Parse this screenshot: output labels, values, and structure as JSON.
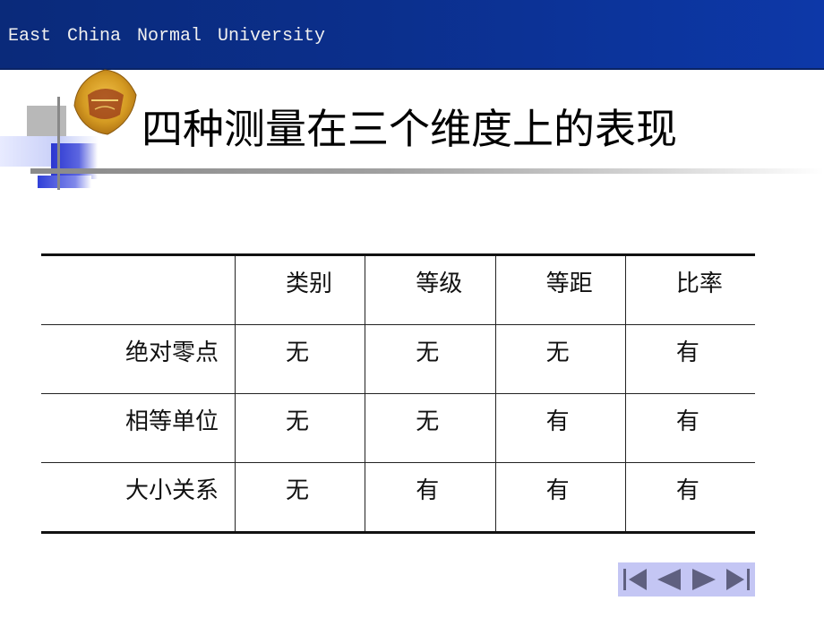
{
  "header": {
    "institution": "East  China  Normal  University"
  },
  "slide": {
    "title": "四种测量在三个维度上的表现"
  },
  "table": {
    "columns": [
      "",
      "类别",
      "等级",
      "等距",
      "比率"
    ],
    "rows": [
      {
        "label": "绝对零点",
        "values": [
          "无",
          "无",
          "无",
          "有"
        ]
      },
      {
        "label": "相等单位",
        "values": [
          "无",
          "无",
          "有",
          "有"
        ]
      },
      {
        "label": "大小关系",
        "values": [
          "无",
          "有",
          "有",
          "有"
        ]
      }
    ]
  },
  "navigation": {
    "buttons": [
      {
        "icon": "first-slide-icon"
      },
      {
        "icon": "previous-slide-icon"
      },
      {
        "icon": "next-slide-icon"
      },
      {
        "icon": "last-slide-icon"
      }
    ],
    "color": "#5f6080",
    "background": "#c4c6f4"
  },
  "colors": {
    "header": "#0b2f8c",
    "accent_blue": "#3a46d6"
  }
}
